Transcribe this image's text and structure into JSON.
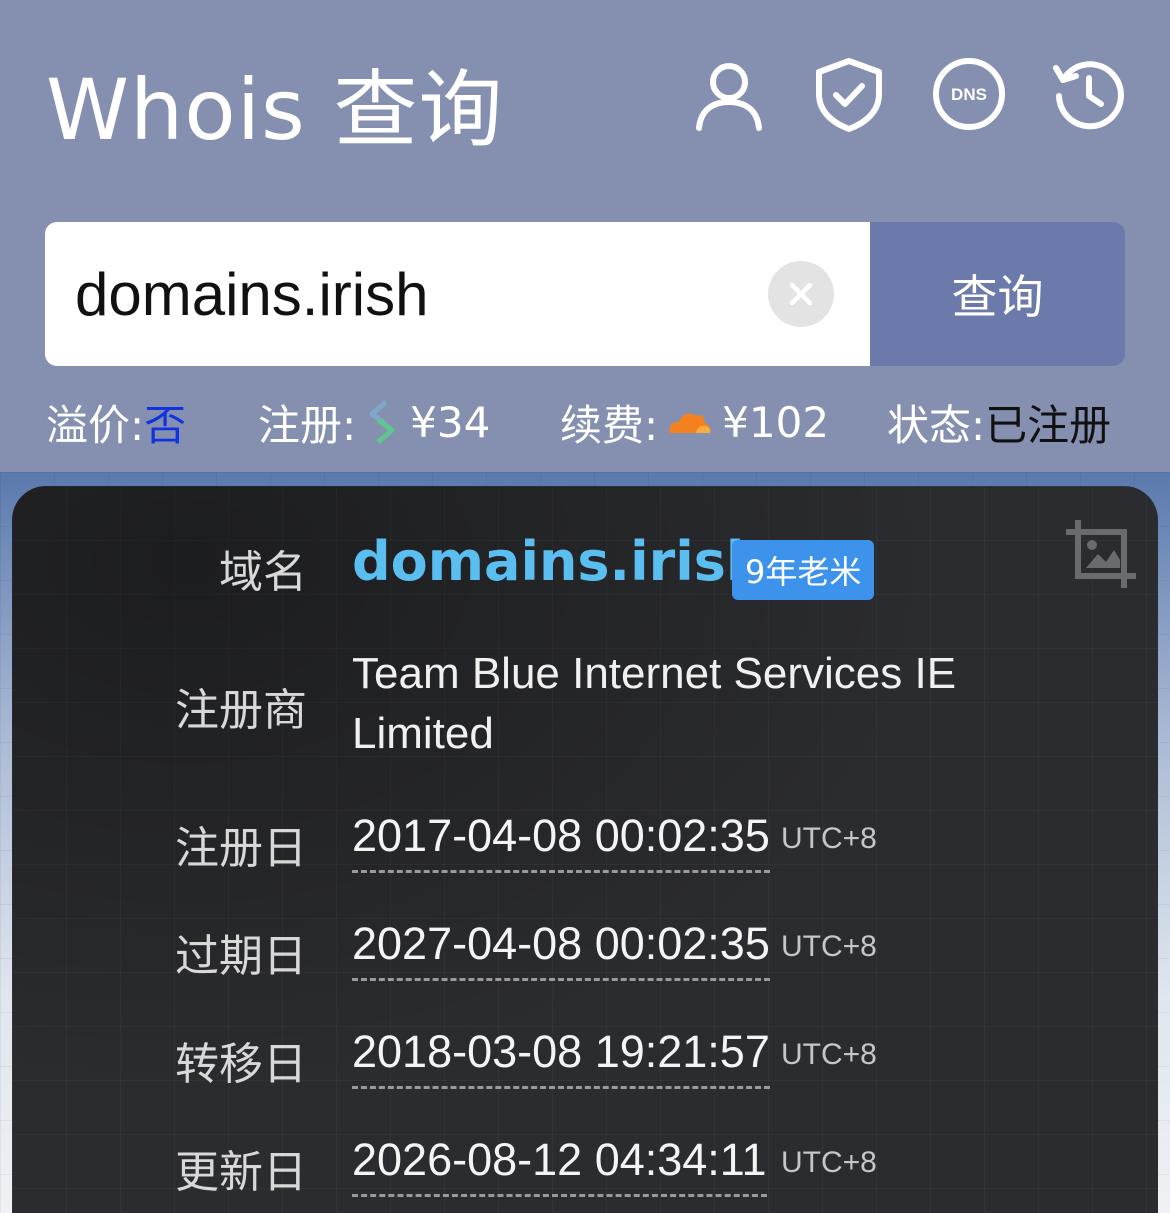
{
  "header": {
    "title": "Whois 查询",
    "icons": [
      "user-icon",
      "shield-check-icon",
      "dns-icon",
      "history-icon"
    ],
    "dns_label": "DNS"
  },
  "search": {
    "value": "domains.irish",
    "button_label": "查询"
  },
  "info": {
    "premium_label": "溢价:",
    "premium_value": "否",
    "register_label": "注册:",
    "register_price": "¥34",
    "renew_label": "续费:",
    "renew_price": "¥102",
    "status_label": "状态:",
    "status_value": "已注册"
  },
  "card": {
    "domain_label": "域名",
    "domain": "domains.irish",
    "age_badge": "9年老米",
    "registrar_label": "注册商",
    "registrar": "Team Blue Internet Services IE Limited",
    "dates": [
      {
        "label": "注册日",
        "value": "2017-04-08 00:02:35",
        "tz": "UTC+8"
      },
      {
        "label": "过期日",
        "value": "2027-04-08 00:02:35",
        "tz": "UTC+8"
      },
      {
        "label": "转移日",
        "value": "2018-03-08 19:21:57",
        "tz": "UTC+8"
      },
      {
        "label": "更新日",
        "value": "2026-08-12 04:34:11",
        "tz": "UTC+8"
      }
    ]
  },
  "colors": {
    "header_bg": "#8590b0",
    "search_button_bg": "#6c7aab",
    "domain_accent": "#5bbef0",
    "badge_bg": "#3d92ec",
    "premium_link": "#1133dd"
  }
}
